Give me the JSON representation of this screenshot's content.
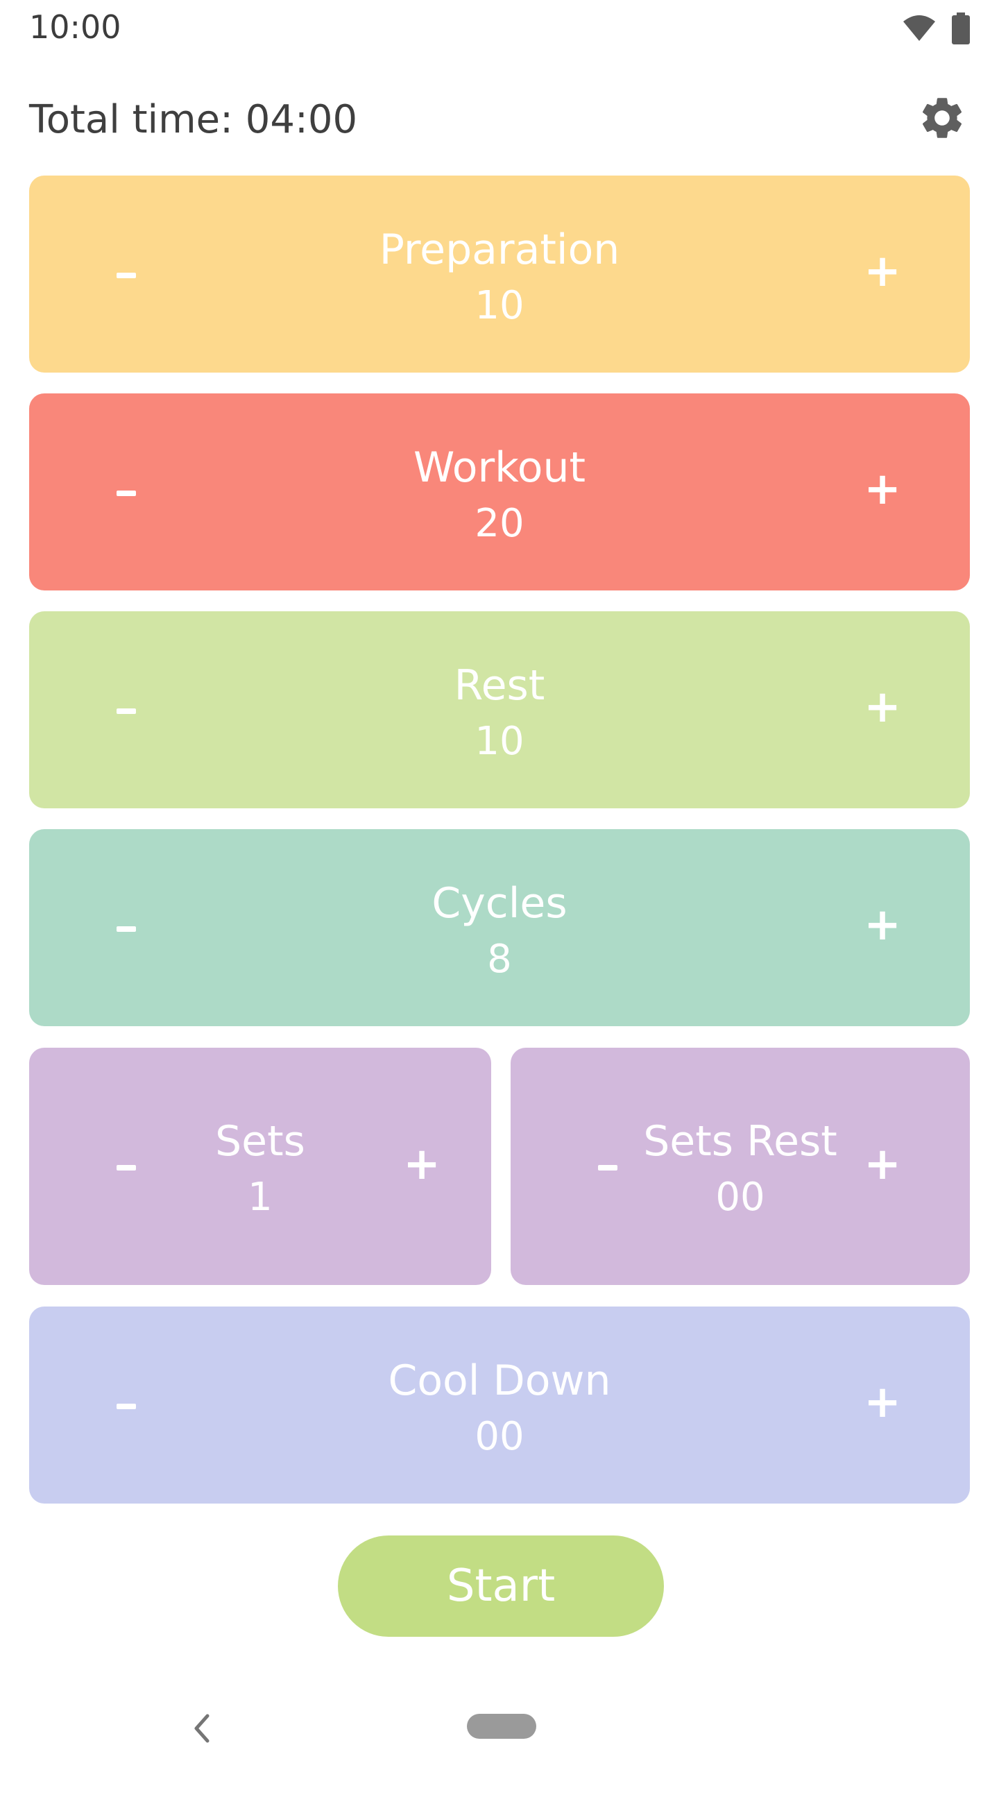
{
  "status_bar": {
    "time": "10:00",
    "wifi_icon": "wifi-icon",
    "battery_icon": "battery-icon"
  },
  "header": {
    "total_time_label": "Total time: 04:00",
    "settings_icon": "gear-icon"
  },
  "cards": {
    "preparation": {
      "title": "Preparation",
      "value": "10",
      "minus": "-",
      "plus": "+",
      "color": "#fdd98d"
    },
    "workout": {
      "title": "Workout",
      "value": "20",
      "minus": "-",
      "plus": "+",
      "color": "#f9877a"
    },
    "rest": {
      "title": "Rest",
      "value": "10",
      "minus": "-",
      "plus": "+",
      "color": "#d1e5a4"
    },
    "cycles": {
      "title": "Cycles",
      "value": "8",
      "minus": "-",
      "plus": "+",
      "color": "#addac7"
    },
    "sets": {
      "title": "Sets",
      "value": "1",
      "minus": "-",
      "plus": "+",
      "color": "#d2b9dc"
    },
    "sets_rest": {
      "title": "Sets Rest",
      "value": "00",
      "minus": "-",
      "plus": "+",
      "color": "#d2b9dc"
    },
    "cool_down": {
      "title": "Cool Down",
      "value": "00",
      "minus": "-",
      "plus": "+",
      "color": "#c8cdf0"
    }
  },
  "start_button": {
    "label": "Start",
    "color": "#c2dd84"
  },
  "nav": {
    "back_icon": "chevron-left-icon",
    "home_icon": "home-pill-icon"
  }
}
